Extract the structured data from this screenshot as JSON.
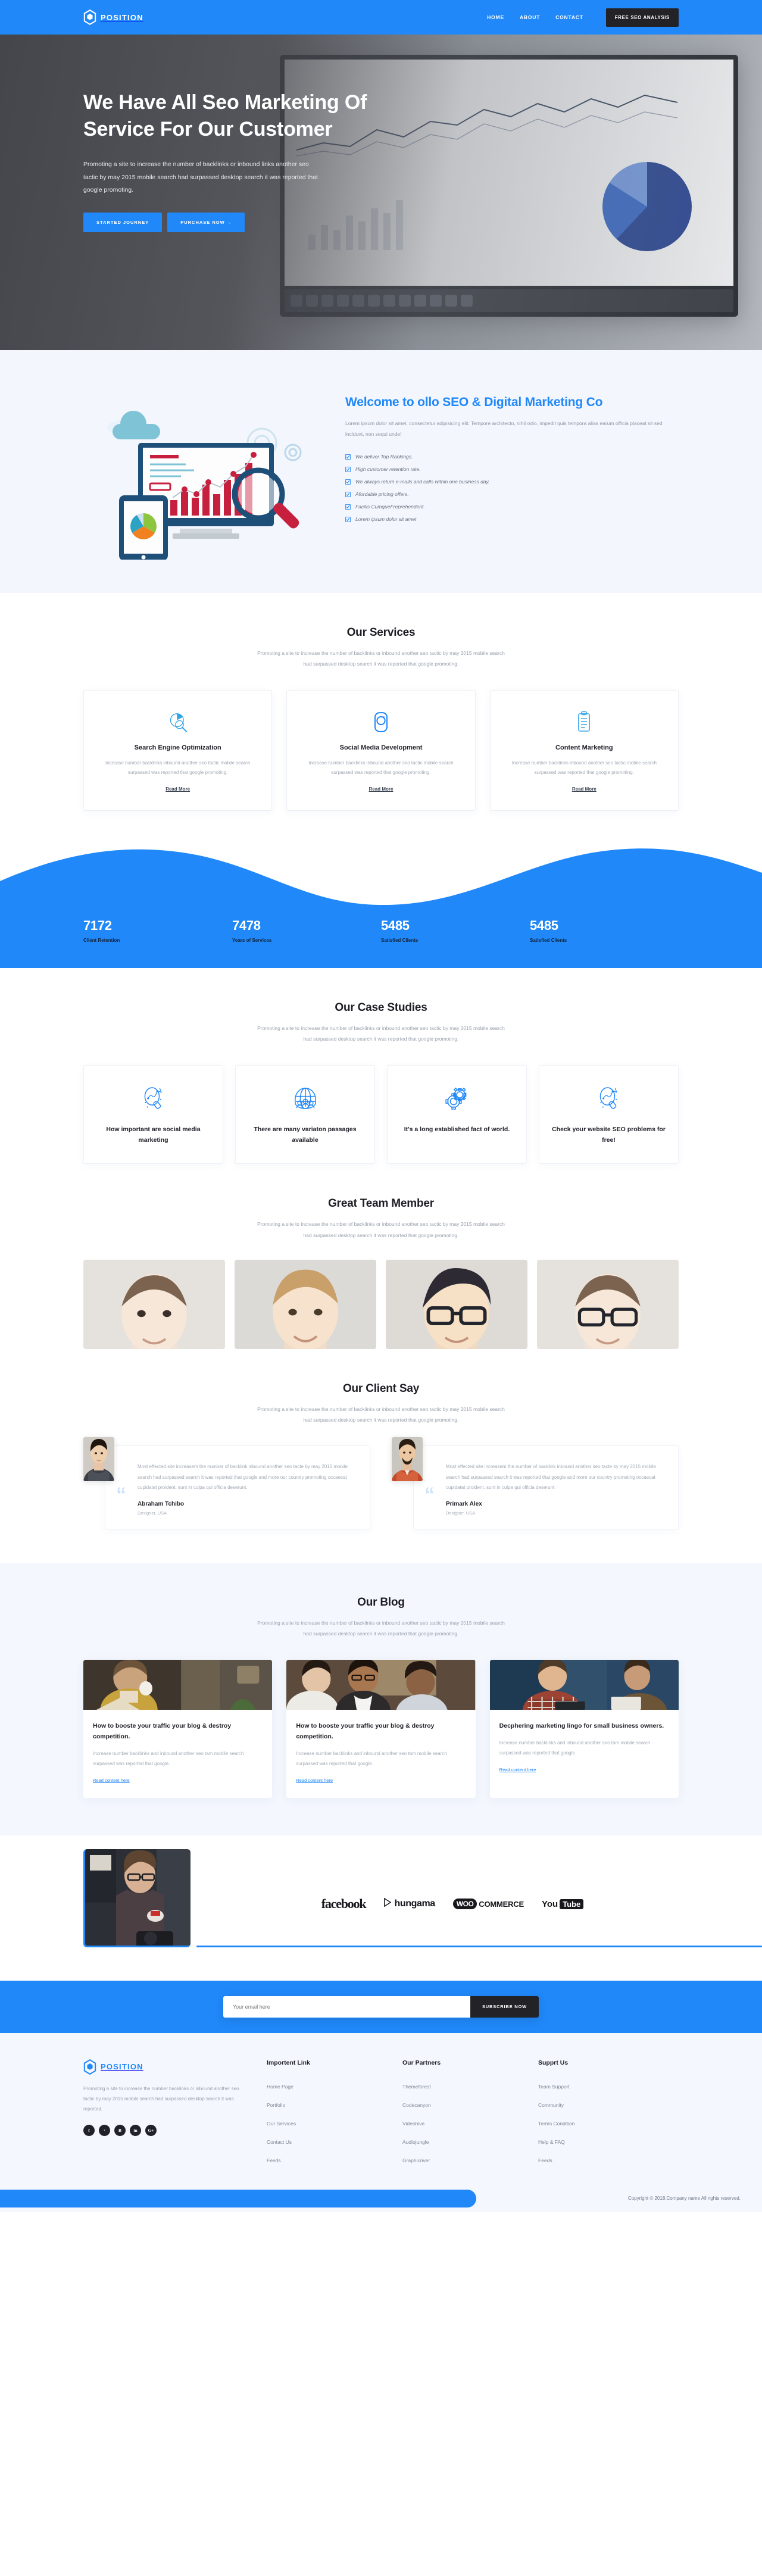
{
  "brand": {
    "name": "POSITION",
    "accent": "#2088f9",
    "dark": "#222227"
  },
  "header": {
    "nav": [
      {
        "label": "HOME"
      },
      {
        "label": "ABOUT"
      },
      {
        "label": "CONTACT"
      }
    ],
    "cta": "FREE SEO ANALYSIS"
  },
  "hero": {
    "title": "We Have All Seo Marketing Of Service For Our Customer",
    "paragraph": "Promoting a site to increase the number of backlinks or inbound links another seo tactic by may 2015 mobile search had surpassed desktop search it was reported that google promoting.",
    "btn_primary": "STARTED JOURNEY",
    "btn_secondary": "PURCHASE NOW →"
  },
  "welcome": {
    "title": "Welcome to ollo SEO & Digital Marketing Co",
    "lede": "Lorem ipsum dolor sit amet, consectetur adipisicing elit. Tempore architecto, nihil odio, impedit quis tempora alias earum officia placeat sit sed incidunt, non sequi unde!",
    "features": [
      "We deliver Top Rankings.",
      "High customer retention rate.",
      "We always return e-mails and calls within one business day.",
      "Afordable pricing offers.",
      "Facilis CumqueFreprehenderit.",
      "Lorem ipsum dolor sit amet"
    ]
  },
  "services": {
    "title": "Our Services",
    "subtitle": "Promoting a site to increase the number of backlinks or inbound another seo tactic by may 2015 mobile search had surpassed desktop search it was reported that google promoting.",
    "cards": [
      {
        "icon": "seo-chart-magnifier-icon",
        "title": "Search Engine Optimization",
        "text": "Increase number backlinks inbound another seo tactic mobile search surpassed was reported that google promoting.",
        "link": "Read More"
      },
      {
        "icon": "instagram-camera-icon",
        "title": "Social Media Development",
        "text": "Increase number backlinks inbound another seo tactic mobile search surpassed was reported that google promoting.",
        "link": "Read More"
      },
      {
        "icon": "clipboard-document-icon",
        "title": "Content Marketing",
        "text": "Increase number backlinks inbound another seo tactic mobile search surpassed was reported that google promoting.",
        "link": "Read More"
      }
    ]
  },
  "stats": [
    {
      "value": "7172",
      "label": "Client Retention"
    },
    {
      "value": "7478",
      "label": "Years of Services"
    },
    {
      "value": "5485",
      "label": "Satisfied Clients"
    },
    {
      "value": "5485",
      "label": "Satisfied Clients"
    }
  ],
  "cases": {
    "title": "Our Case Studies",
    "subtitle": "Promoting a site to increase the number of backlinks or inbound another seo tactic by may 2015 mobile search had surpassed desktop search it was reported that google promoting.",
    "cards": [
      {
        "icon": "magnifier-graph-icon",
        "title": "How important are social media marketing"
      },
      {
        "icon": "globe-people-icon",
        "title": "There are many variaton passages available"
      },
      {
        "icon": "gears-icon",
        "title": "It's a long established fact of world."
      },
      {
        "icon": "magnifier-graph-icon",
        "title": "Check your website SEO problems for free!"
      }
    ]
  },
  "team": {
    "title": "Great Team Member",
    "subtitle": "Promoting a site to increase the number of backlinks or inbound another seo tactic by may 2015 mobile search had surpassed desktop search it was reported that google promoting.",
    "members": [
      {
        "name": "team-member-1"
      },
      {
        "name": "team-member-2"
      },
      {
        "name": "team-member-3"
      },
      {
        "name": "team-member-4"
      }
    ]
  },
  "testimonials": {
    "title": "Our Client Say",
    "subtitle": "Promoting a site to increase the number of backlinks or inbound another seo tactic by may 2015 mobile search had surpassed desktop search it was reported that google promoting.",
    "items": [
      {
        "text": "Most effected site increasem the number of backlink inbound another seo tacte by may 2015 mobile search had surpassed search it was reported that google and more our country promoting occaecat cupidatat proident, sunt in culpa qui officia deserunt.",
        "name": "Abraham Tchibo",
        "role": "Designer, USA"
      },
      {
        "text": "Most effected site increasem the number of backlink inbound another seo tacte by may 2015 mobile search had surpassed search it was reported that google and more our country promoting occaecat cupidatat proident, sunt in culpa qui officia deserunt.",
        "name": "Primark Alex",
        "role": "Designer, USA"
      }
    ]
  },
  "blog": {
    "title": "Our Blog",
    "subtitle": "Promoting a site to increase the number of backlinks or inbound another seo tactic by may 2015 mobile search had surpassed desktop search it was reported that google promoting.",
    "posts": [
      {
        "title": "How to booste your traffic your blog & destroy competition.",
        "text": "Increase number backlinks and inbound another seo tam mobile search surpassed was reported that google.",
        "link": "Read content here"
      },
      {
        "title": "How to booste your traffic your blog & destroy competition.",
        "text": "Increase number backlinks and inbound another seo tam mobile search surpassed was reported that google.",
        "link": "Read content here"
      },
      {
        "title": "Decphering marketing lingo for small business owners.",
        "text": "Increase number backlinks and inbound another seo tam mobile search surpassed was reported that google.",
        "link": "Read content here"
      }
    ]
  },
  "brands": {
    "facebook": "facebook",
    "hungama": "hungama",
    "woo_badge": "WOO",
    "woo_text": "COMMERCE",
    "youtube_you": "You",
    "youtube_tube": "Tube"
  },
  "newsletter": {
    "placeholder": "Your email here",
    "button": "SUBSCRIBE NOW"
  },
  "footer": {
    "about": "Promoting a site to increase the number backlinks or inbound another seo tactic by may 2015 mobile search had surpassed desktop search it was reported.",
    "socials": [
      {
        "icon": "facebook-icon",
        "glyph": "f"
      },
      {
        "icon": "twitter-icon",
        "glyph": "ᵛ"
      },
      {
        "icon": "behance-icon",
        "glyph": "Ƀ"
      },
      {
        "icon": "linkedin-icon",
        "glyph": "in"
      },
      {
        "icon": "google-plus-icon",
        "glyph": "G+"
      }
    ],
    "columns": [
      {
        "title": "Importent Link",
        "links": [
          "Home Page",
          "Portfolio",
          "Our Services",
          "Contact Us",
          "Feeds"
        ]
      },
      {
        "title": "Our Partners",
        "links": [
          "Themeforest",
          "Codecanyon",
          "Videohive",
          "Audiojungle",
          "Graphicriver"
        ]
      },
      {
        "title": "Supprt Us",
        "links": [
          "Team Support",
          "Community",
          "Terms Condition",
          "Help & FAQ",
          "Feeds"
        ]
      }
    ],
    "copyright": "Copyright © 2018.Company name All rights reserved."
  }
}
